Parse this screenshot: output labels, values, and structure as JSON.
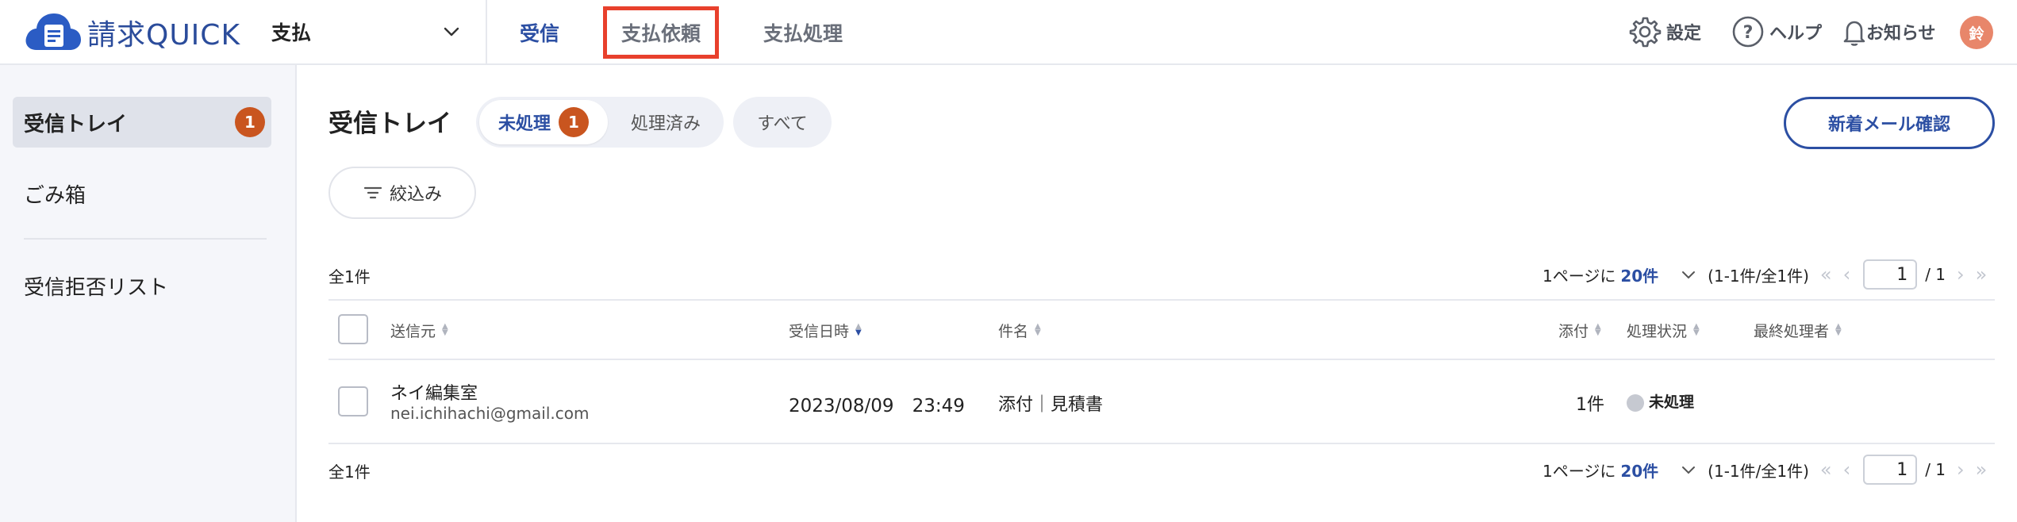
{
  "header": {
    "logo_text": "請求QUICK",
    "module": "支払",
    "tabs": [
      {
        "label": "受信",
        "active": true
      },
      {
        "label": "支払依頼",
        "highlighted": true
      },
      {
        "label": "支払処理"
      }
    ],
    "settings": "設定",
    "help": "ヘルプ",
    "notifications": "お知らせ",
    "avatar_initial": "鈴",
    "accent_color": "#2c4fa3",
    "highlight_color": "#e8402c"
  },
  "sidebar": {
    "items": [
      {
        "label": "受信トレイ",
        "badge": "1",
        "active": true
      },
      {
        "label": "ごみ箱"
      },
      {
        "label": "受信拒否リスト"
      }
    ]
  },
  "main": {
    "title": "受信トレイ",
    "segments": [
      {
        "label": "未処理",
        "badge": "1",
        "active": true
      },
      {
        "label": "処理済み"
      }
    ],
    "all_label": "すべて",
    "new_mail_button": "新着メール確認",
    "filter_label": "絞込み",
    "total": "全1件",
    "pager": {
      "per_page_prefix": "1ページに",
      "per_page": "20件",
      "range": "(1-1件/全1件)",
      "first": "«",
      "prev": "‹",
      "page": "1",
      "of": "/ 1",
      "next": "›",
      "last": "»"
    },
    "columns": {
      "sender": "送信元",
      "received_at": "受信日時",
      "subject": "件名",
      "attachments": "添付",
      "status": "処理状況",
      "last_handler": "最終処理者"
    },
    "rows": [
      {
        "sender_name": "ネイ編集室",
        "sender_email": "nei.ichihachi@gmail.com",
        "received_at": "2023/08/09　23:49",
        "subject": "添付｜見積書",
        "attachments": "1件",
        "status": "未処理",
        "last_handler": ""
      }
    ]
  }
}
